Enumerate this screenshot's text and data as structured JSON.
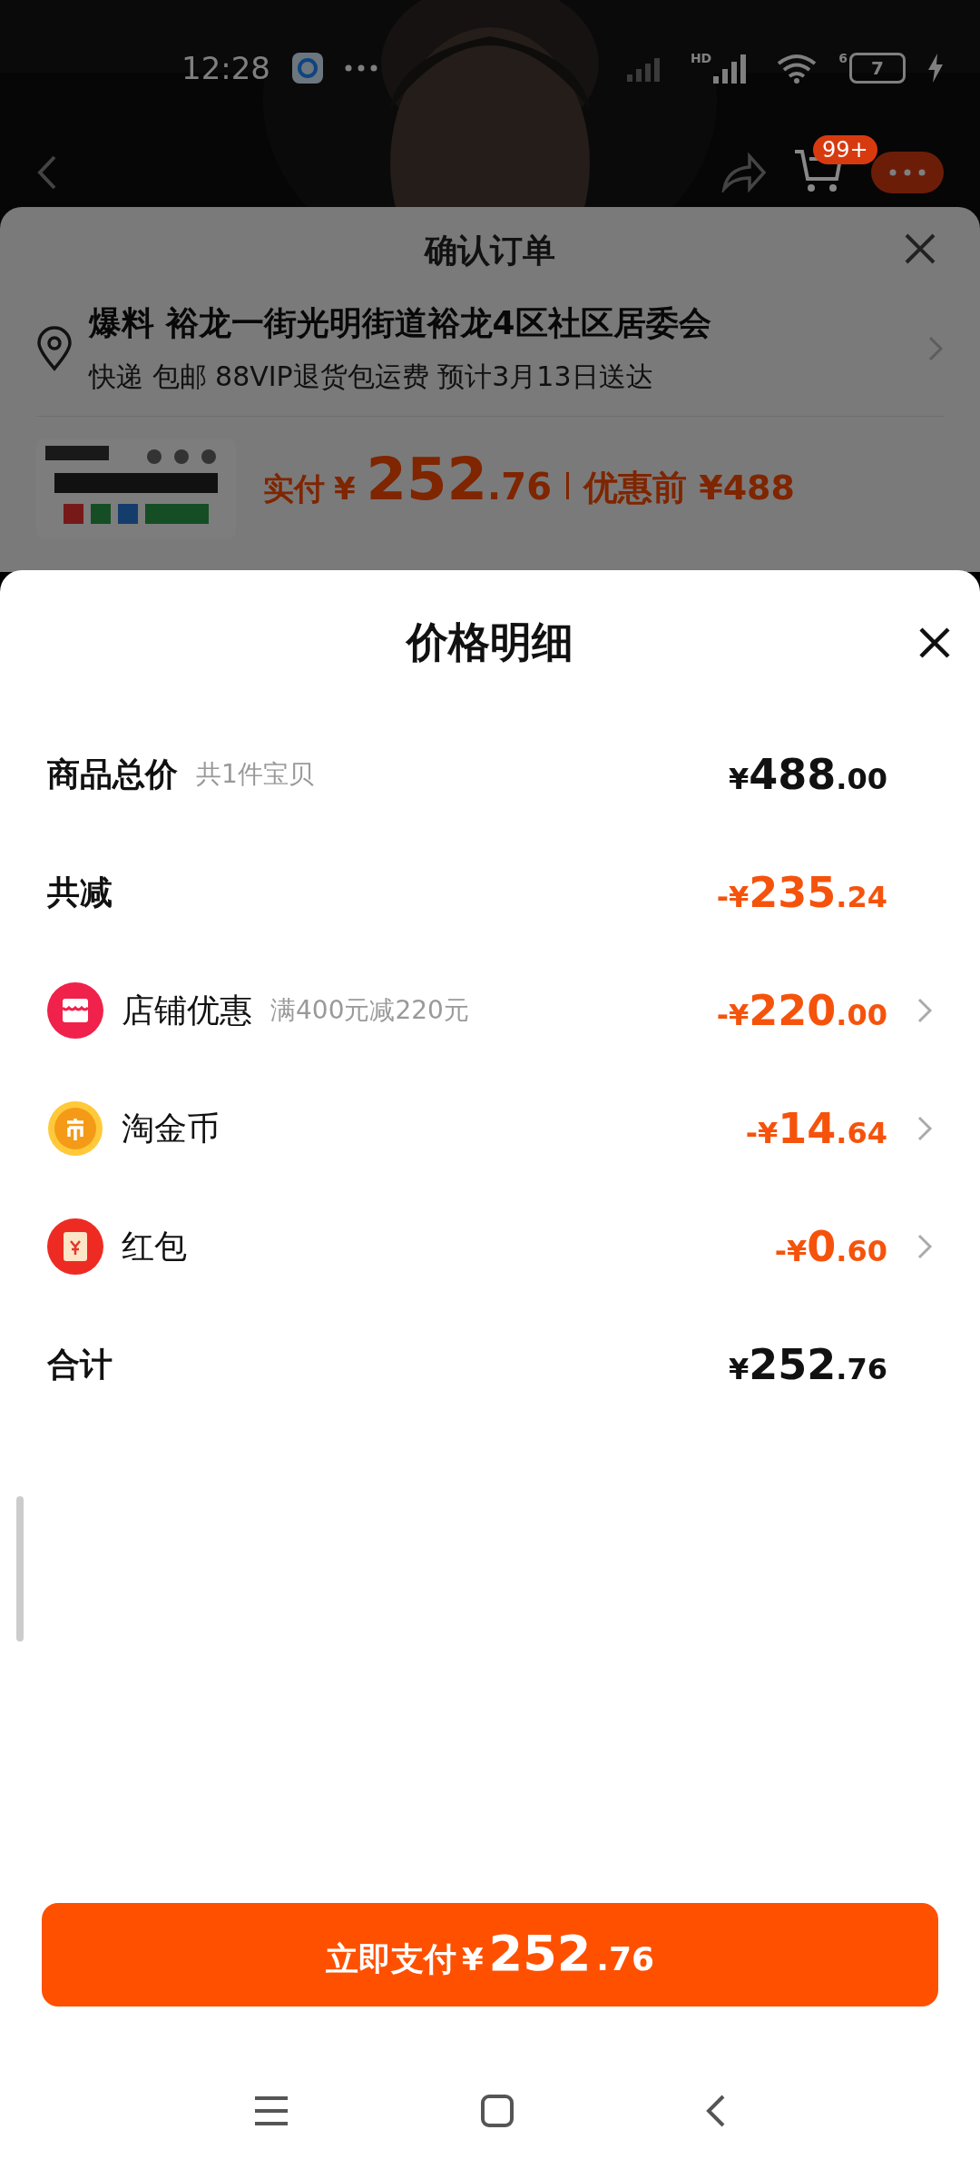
{
  "status_bar": {
    "time": "12:28",
    "signal_label": "HD",
    "wifi_label": "6",
    "battery": "7"
  },
  "top_nav": {
    "cart_badge": "99+"
  },
  "order_sheet": {
    "title": "确认订单",
    "address": "爆料 裕龙一街光明街道裕龙4区社区居委会",
    "delivery": "快递 包邮 88VIP退货包运费 预计3月13日送达",
    "paid_label": "实付",
    "paid_amount": "¥252.76",
    "original_price": "优惠前 ¥488"
  },
  "price_sheet": {
    "title": "价格明细",
    "rows": [
      {
        "kind": "subtotal",
        "label": "商品总价",
        "note": "共1件宝贝",
        "amount": "¥488.00"
      },
      {
        "kind": "total_discount",
        "label": "共减",
        "amount": "-¥235.24"
      },
      {
        "kind": "store_discount",
        "label": "店铺优惠",
        "note": "满400元减220元",
        "amount": "-¥220.00"
      },
      {
        "kind": "coin_discount",
        "label": "淘金币",
        "amount": "-¥14.64"
      },
      {
        "kind": "envelope_discount",
        "label": "红包",
        "amount": "-¥0.60"
      },
      {
        "kind": "total",
        "label": "合计",
        "amount": "¥252.76"
      }
    ]
  },
  "pay_button": {
    "label": "立即支付",
    "amount": "¥252.76"
  }
}
